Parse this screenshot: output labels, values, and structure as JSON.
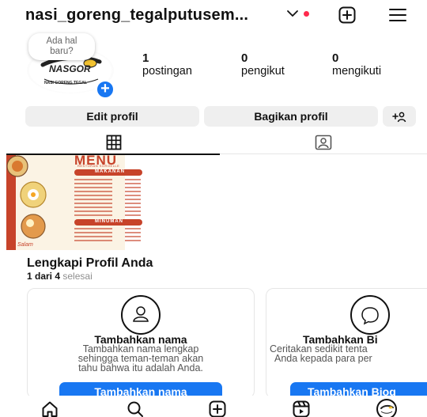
{
  "header": {
    "username": "nasi_goreng_tegalputusem...",
    "chevron_icon": "chevron-down-icon",
    "notification_color": "#ff2a4d",
    "new_post_icon": "plus-square-icon",
    "menu_icon": "hamburger-menu-icon"
  },
  "profile": {
    "note_line1": "Ada hal",
    "note_line2": "baru?",
    "avatar_text": "NASGOR",
    "avatar_subtext": "NASI GORENG TEGAL",
    "add_badge": "+",
    "stats": {
      "posts": {
        "count": "1",
        "label": "postingan"
      },
      "followers": {
        "count": "0",
        "label": "pengikut"
      },
      "following": {
        "count": "0",
        "label": "mengikuti"
      }
    }
  },
  "actions": {
    "edit_profile": "Edit profil",
    "share_profile": "Bagikan profil",
    "add_person_icon": "add-person-icon"
  },
  "tabs": {
    "grid_icon": "grid-icon",
    "tagged_icon": "tagged-person-icon"
  },
  "post": {
    "title": "MENU",
    "subtitle": "RESTORAN SOROELLE",
    "section1": "MAKANAN",
    "section2": "MINUMAN",
    "footer": "Salam"
  },
  "complete_profile": {
    "title": "Lengkapi Profil Anda",
    "progress_bold": "1 dari 4",
    "progress_rest": "selesai",
    "cards": [
      {
        "icon": "person-outline-icon",
        "title": "Tambahkan nama",
        "desc_line1": "Tambahkan nama lengkap",
        "desc_line2": "sehingga teman-teman akan",
        "desc_line3": "tahu bahwa itu adalah Anda.",
        "cta": "Tambahkan nama"
      },
      {
        "icon": "speech-bubble-icon",
        "title": "Tambahkan Bi",
        "desc_line1": "Ceritakan sedikit tenta",
        "desc_line2": "Anda kepada para per",
        "cta": "Tambahkan Biog"
      }
    ]
  },
  "bottom_nav": {
    "home_icon": "home-icon",
    "search_icon": "search-icon",
    "create_icon": "plus-square-icon",
    "reels_icon": "reels-icon",
    "profile_icon": "profile-avatar-icon"
  },
  "colors": {
    "accent": "#1877f2",
    "button_bg": "#efefef",
    "muted_text": "#8e8e8e"
  }
}
